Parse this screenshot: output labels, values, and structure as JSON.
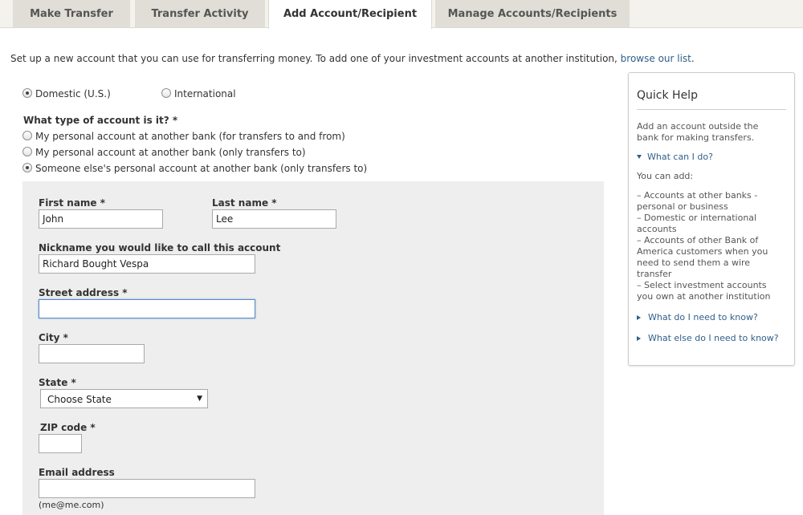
{
  "tabs": [
    {
      "label": "Make Transfer"
    },
    {
      "label": "Transfer Activity"
    },
    {
      "label": "Add Account/Recipient"
    },
    {
      "label": "Manage Accounts/Recipients"
    }
  ],
  "intro": {
    "text": "Set up a new account that you can use for transferring money. To add one of your investment accounts at another institution, ",
    "link": "browse our list",
    "end": "."
  },
  "location": {
    "options": [
      {
        "label": "Domestic (U.S.)",
        "checked": true
      },
      {
        "label": "International",
        "checked": false
      }
    ]
  },
  "account_type": {
    "question": "What type of account is it? *",
    "options": [
      {
        "label": "My personal account at another bank (for transfers to and from)",
        "checked": false
      },
      {
        "label": "My personal account at another bank (only transfers to)",
        "checked": false
      },
      {
        "label": "Someone else's personal account at another bank (only transfers to)",
        "checked": true
      }
    ]
  },
  "form": {
    "first_name": {
      "label": "First name *",
      "value": "John"
    },
    "last_name": {
      "label": "Last name *",
      "value": "Lee"
    },
    "nickname": {
      "label": "Nickname you would like to call this account",
      "value": "Richard Bought Vespa"
    },
    "street": {
      "label": "Street address *",
      "value": ""
    },
    "city": {
      "label": "City *",
      "value": ""
    },
    "state": {
      "label": "State *",
      "selected": "Choose State"
    },
    "zip": {
      "label": "ZIP code *",
      "value": ""
    },
    "email": {
      "label": "Email address",
      "value": "",
      "hint": "(me@me.com)"
    }
  },
  "quick_help": {
    "title": "Quick Help",
    "intro": "Add an account outside the bank for making transfers.",
    "what_can_i_do": "What can I do?",
    "you_can_add": "You can add:",
    "items": [
      "– Accounts at other banks - personal or business",
      "– Domestic or international accounts",
      "– Accounts of other Bank of America customers when you need to send them a wire transfer",
      "– Select investment accounts you own at another institution"
    ],
    "need_to_know": "What do I need to know?",
    "else_need_to_know": "What else do I need to know?"
  }
}
